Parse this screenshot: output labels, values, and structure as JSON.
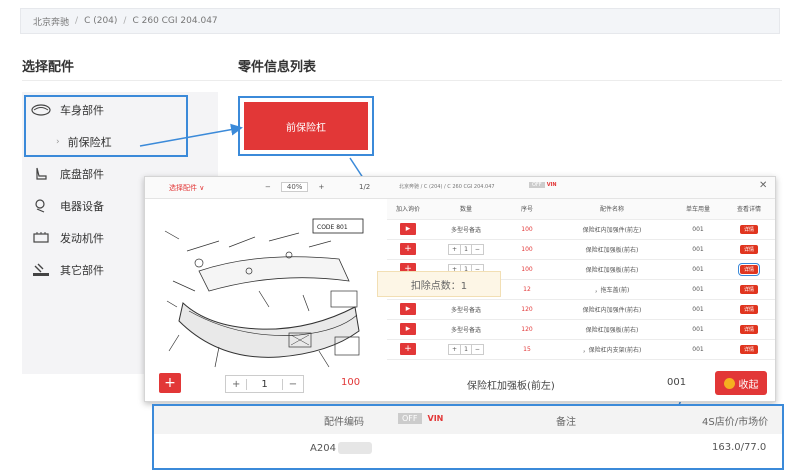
{
  "breadcrumb": [
    "北京奔驰",
    "C (204)",
    "C 260 CGI 204.047"
  ],
  "headings": {
    "select_parts": "选择配件",
    "parts_list": "零件信息列表"
  },
  "sidebar": {
    "items": [
      {
        "label": "车身部件",
        "icon": "car-body-icon"
      },
      {
        "label": "前保险杠",
        "icon": "chevron-right-icon"
      },
      {
        "label": "底盘部件",
        "icon": "seat-icon"
      },
      {
        "label": "电器设备",
        "icon": "electric-icon"
      },
      {
        "label": "发动机件",
        "icon": "engine-icon"
      },
      {
        "label": "其它部件",
        "icon": "service-icon"
      }
    ]
  },
  "main": {
    "bumper_button": "前保险杠"
  },
  "modal": {
    "select_parts": "选择配件 ∨",
    "zoom": "40%",
    "zoom_minus": "−",
    "zoom_plus": "+",
    "page": "1/2",
    "breadcrumb": "北京奔驰 / C (204) / C 260 CGI 204.047",
    "off": "OFF",
    "vin": "VIN",
    "close": "✕",
    "diagram_code": "CODE 801",
    "headers": [
      "加入询价",
      "数量",
      "序号",
      "配件名称",
      "单车用量",
      "查看详情"
    ],
    "rows": [
      {
        "qty": "多型号备选",
        "seq": "100",
        "name": "保险杠内加强件(前左)",
        "usage": "001",
        "detail": "详情"
      },
      {
        "qty": "1",
        "seq": "100",
        "name": "保险杠加强板(前右)",
        "usage": "001",
        "detail": "详情"
      },
      {
        "qty": "1",
        "seq": "100",
        "name": "保险杠加强板(前右)",
        "usage": "001",
        "detail": "详情"
      },
      {
        "qty": "",
        "seq": "12",
        "name": "，拖车盖(前)",
        "usage": "001",
        "detail": "详情"
      },
      {
        "qty": "多型号备选",
        "seq": "120",
        "name": "保险杠内加强件(前右)",
        "usage": "001",
        "detail": "详情"
      },
      {
        "qty": "多型号备选",
        "seq": "120",
        "name": "保险杠加强板(前右)",
        "usage": "001",
        "detail": "详情"
      },
      {
        "qty": "1",
        "seq": "15",
        "name": "，保险杠内支架(前右)",
        "usage": "001",
        "detail": "详情"
      }
    ],
    "toast": "扣除点数：1",
    "footer": {
      "add": "+",
      "minus": "−",
      "plus": "+",
      "qty": "1",
      "seq": "100",
      "name": "保险杠加强板(前左)",
      "usage": "001",
      "collapse": "收起"
    }
  },
  "bottom_panel": {
    "headers": {
      "code": "配件编码",
      "off": "OFF",
      "vin": "VIN",
      "remark": "备注",
      "price": "4S店价/市场价"
    },
    "row": {
      "code": "A204",
      "price": "163.0/77.0"
    }
  },
  "colors": {
    "accent_red": "#e23737",
    "highlight_blue": "#3b8ad9"
  }
}
